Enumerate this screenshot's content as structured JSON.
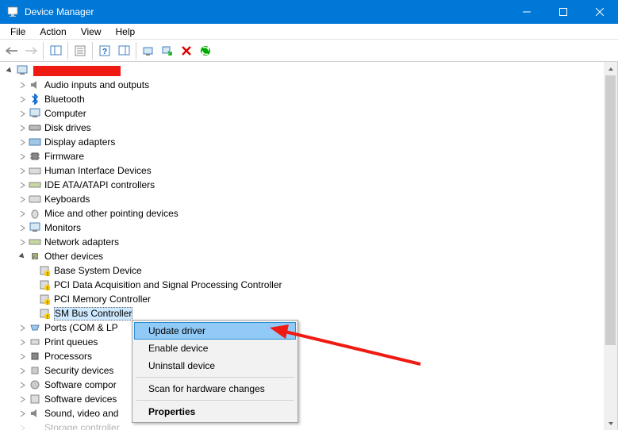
{
  "window": {
    "title": "Device Manager"
  },
  "menu": {
    "file": "File",
    "action": "Action",
    "view": "View",
    "help": "Help"
  },
  "tree": {
    "root_redacted": true,
    "items": {
      "audio": "Audio inputs and outputs",
      "bluetooth": "Bluetooth",
      "computer": "Computer",
      "disk": "Disk drives",
      "display": "Display adapters",
      "firmware": "Firmware",
      "hid": "Human Interface Devices",
      "ide": "IDE ATA/ATAPI controllers",
      "keyboards": "Keyboards",
      "mice": "Mice and other pointing devices",
      "monitors": "Monitors",
      "network": "Network adapters",
      "other": "Other devices",
      "other_children": {
        "base": "Base System Device",
        "pcidata": "PCI Data Acquisition and Signal Processing Controller",
        "pcimem": "PCI Memory Controller",
        "smbus": "SM Bus Controller"
      },
      "ports": "Ports (COM & LP",
      "print": "Print queues",
      "processors": "Processors",
      "security": "Security devices",
      "swcomp": "Software compor",
      "swdev": "Software devices",
      "sound": "Sound, video and",
      "storage_cut": "Storage controller"
    }
  },
  "context_menu": {
    "update": "Update driver",
    "enable": "Enable device",
    "uninstall": "Uninstall device",
    "scan": "Scan for hardware changes",
    "properties": "Properties"
  }
}
